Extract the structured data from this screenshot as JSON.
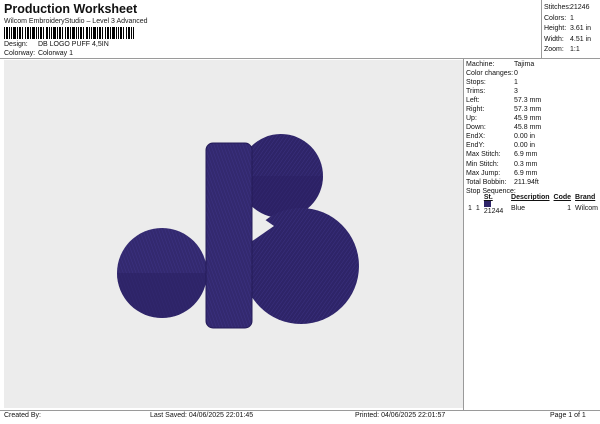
{
  "header": {
    "title": "Production Worksheet",
    "subtitle": "Wilcom EmbroideryStudio – Level 3 Advanced",
    "design_label": "Design:",
    "design_value": "DB LOGO PUFF 4,5IN",
    "colorway_label": "Colorway:",
    "colorway_value": "Colorway 1"
  },
  "summary": [
    {
      "label": "Stitches:",
      "value": "21246"
    },
    {
      "label": "Colors:",
      "value": "1"
    },
    {
      "label": "Height:",
      "value": "3.61 in"
    },
    {
      "label": "Width:",
      "value": "4.51 in"
    },
    {
      "label": "Zoom:",
      "value": "1:1"
    }
  ],
  "details": [
    {
      "label": "Machine:",
      "value": "Tajima"
    },
    {
      "label": "Color changes:",
      "value": "0"
    },
    {
      "label": "Stops:",
      "value": "1"
    },
    {
      "label": "Trims:",
      "value": "3"
    },
    {
      "label": "Left:",
      "value": "57.3 mm"
    },
    {
      "label": "Right:",
      "value": "57.3 mm"
    },
    {
      "label": "Up:",
      "value": "45.9 mm"
    },
    {
      "label": "Down:",
      "value": "45.8 mm"
    },
    {
      "label": "EndX:",
      "value": "0.00 in"
    },
    {
      "label": "EndY:",
      "value": "0.00 in"
    },
    {
      "label": "Max Stitch:",
      "value": "6.9 mm"
    },
    {
      "label": "Min Stitch:",
      "value": "0.3 mm"
    },
    {
      "label": "Max Jump:",
      "value": "6.9 mm"
    },
    {
      "label": "Total Bobbin:",
      "value": "211.94ft"
    }
  ],
  "stop_sequence": {
    "title": "Stop Sequence:",
    "columns": [
      "",
      "",
      "St.",
      "Description",
      "Code",
      "Brand"
    ],
    "rows": [
      {
        "stop": "1",
        "color_num": "1",
        "stitches": "21244",
        "description": "Blue",
        "code": "1",
        "brand": "Wilcom"
      }
    ]
  },
  "colors": {
    "thread": "#2e2468",
    "thread_light": "#3a2f7e",
    "canvas": "#ececec"
  },
  "footer": {
    "created_by": "Created By:",
    "last_saved": "Last Saved: 04/06/2025 22:01:45",
    "printed": "Printed: 04/06/2025 22:01:57",
    "page": "Page 1 of 1"
  }
}
